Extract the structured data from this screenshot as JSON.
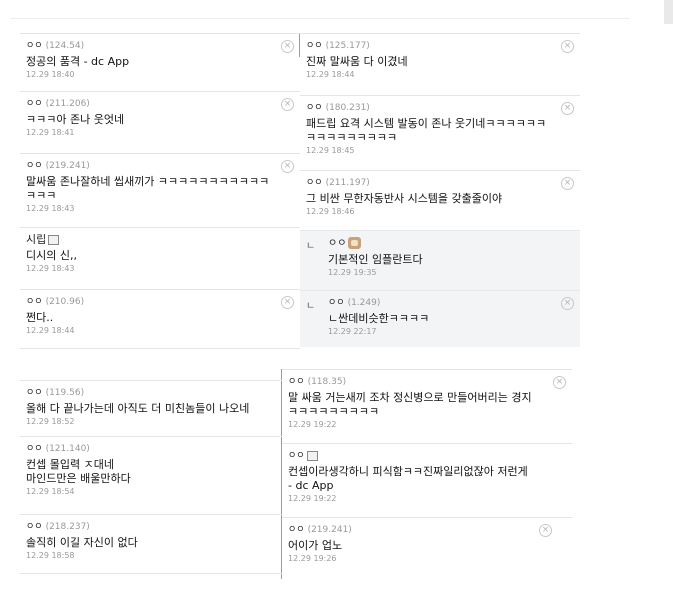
{
  "top_panel": {
    "left": [
      {
        "nick": "ㅇㅇ",
        "ip": "(124.54)",
        "text": "정공의 품격 - dc App",
        "date": "12.29 18:40",
        "delete": true
      },
      {
        "nick": "ㅇㅇ",
        "ip": "(211.206)",
        "text": "ㅋㅋㅋ아 존나 웃엇네",
        "date": "12.29 18:41",
        "delete": true
      },
      {
        "nick": "ㅇㅇ",
        "ip": "(219.241)",
        "text": "말싸움 존나잘하네 씹새끼가 ㅋㅋㅋㅋㅋㅋㅋㅋㅋㅋㅋ\nㅋㅋㅋ",
        "date": "12.29 18:43",
        "delete": true
      },
      {
        "nick": "시립",
        "ip": "",
        "text": "디시의 신,,",
        "date": "12.29 18:43",
        "delete": false,
        "icon": "memo-icon"
      },
      {
        "nick": "ㅇㅇ",
        "ip": "(210.96)",
        "text": "쩐다..",
        "date": "12.29 18:44",
        "delete": true
      }
    ],
    "right": [
      {
        "nick": "ㅇㅇ",
        "ip": "(125.177)",
        "text": "진짜 말싸움 다 이겼네",
        "date": "12.29 18:44",
        "delete": true
      },
      {
        "nick": "ㅇㅇ",
        "ip": "(180.231)",
        "text": "패드립 요격 시스템 발동이 존나 웃기네ㅋㅋㅋㅋㅋㅋ\nㅋㅋㅋㅋㅋㅋㅋㅋㅋ",
        "date": "12.29 18:45",
        "delete": true
      },
      {
        "nick": "ㅇㅇ",
        "ip": "(211.197)",
        "text": "그 비싼 무한자동반사 시스템을 갖출줄이야",
        "date": "12.29 18:46",
        "delete": true
      },
      {
        "nick": "ㅇㅇ",
        "ip": "",
        "text": "기본적인 임플란트다",
        "date": "12.29 19:35",
        "delete": false,
        "reply": true,
        "icon": "dog-avatar-icon"
      },
      {
        "nick": "ㅇㅇ",
        "ip": "(1.249)",
        "text": "ㄴ싼데비슷한ㅋㅋㅋㅋ",
        "date": "12.29 22:17",
        "delete": true,
        "reply": true
      }
    ]
  },
  "bottom_panel": {
    "left": [
      {
        "nick": "ㅇㅇ",
        "ip": "(119.56)",
        "text": "올해 다 끝나가는데 아직도 더 미친놈들이 나오네",
        "date": "12.29 18:52",
        "delete": false
      },
      {
        "nick": "ㅇㅇ",
        "ip": "(121.140)",
        "text": "컨셉 몰입력 ㅈ대네\n마인드만은 배울만하다",
        "date": "12.29 18:54",
        "delete": false
      },
      {
        "nick": "ㅇㅇ",
        "ip": "(218.237)",
        "text": "솔직히 이길 자신이 없다",
        "date": "12.29 18:58",
        "delete": false
      }
    ],
    "right": [
      {
        "nick": "ㅇㅇ",
        "ip": "(118.35)",
        "text": "말 싸움 거는새끼 조차 정신병으로 만들어버리는 경지\nㅋㅋㅋㅋㅋㅋㅋㅋㅋ",
        "date": "12.29 19:22",
        "delete": true
      },
      {
        "nick": "ㅇㅇ",
        "ip": "",
        "text": "컨셉이라생각하니 피식함ㅋㅋ진짜일리없잖아 저런게\n- dc App",
        "date": "12.29 19:22",
        "delete": false,
        "icon": "memo-icon"
      },
      {
        "nick": "ㅇㅇ",
        "ip": "(219.241)",
        "text": "어이가 업노",
        "date": "12.29 19:26",
        "delete": true
      }
    ]
  },
  "glyphs": {
    "close": "×",
    "reply_arrow": "ㄴ"
  }
}
